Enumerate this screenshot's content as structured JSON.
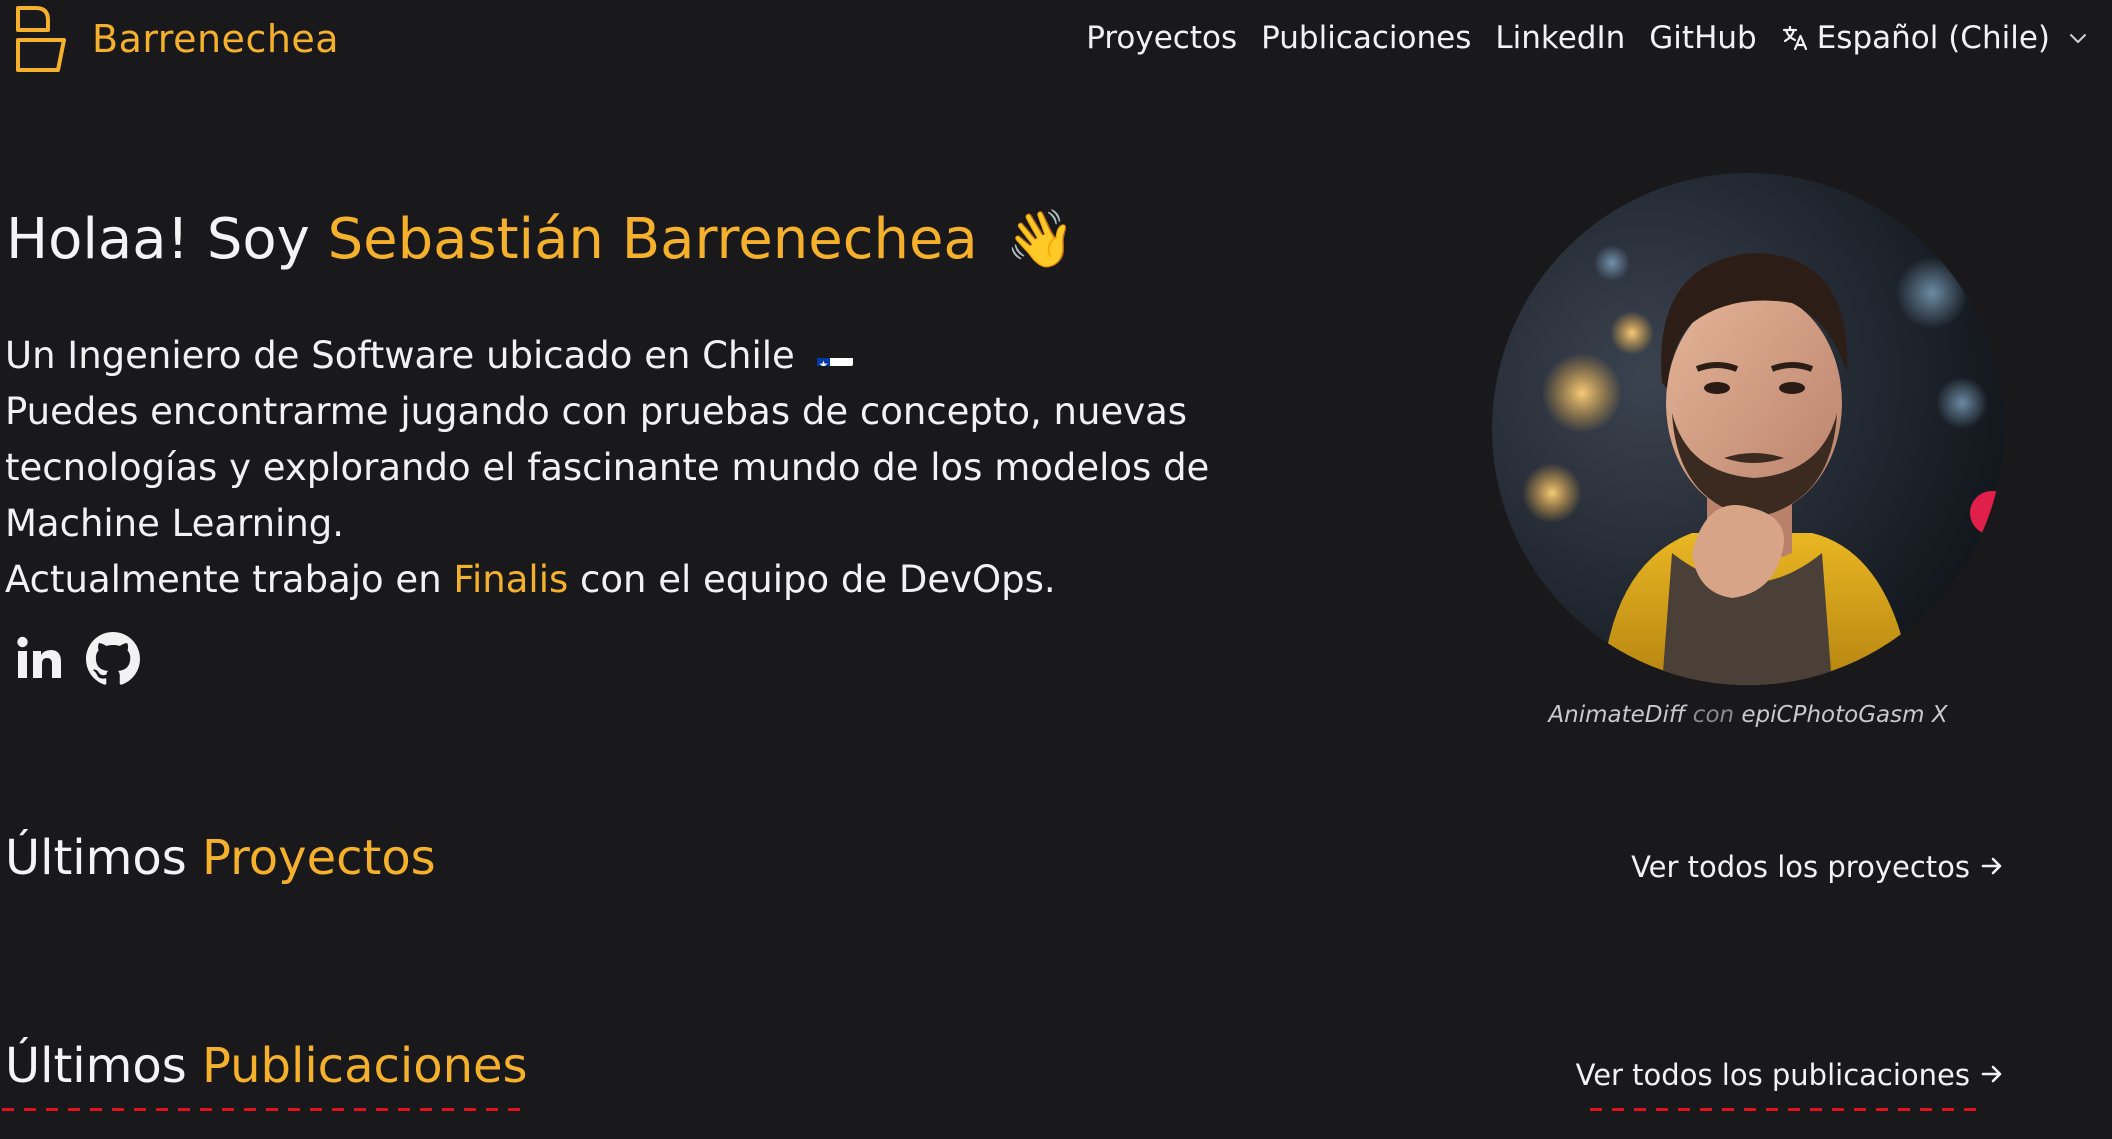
{
  "brand": {
    "name": "Barrenechea",
    "logo_icon": "folded-page-logo-icon"
  },
  "nav": {
    "links": [
      "Proyectos",
      "Publicaciones",
      "LinkedIn",
      "GitHub"
    ],
    "language": {
      "icon": "translate-icon",
      "label": "Español (Chile)"
    }
  },
  "hero": {
    "greeting": "Holaa! Soy ",
    "name": "Sebastián Barrenechea",
    "wave": "👋",
    "line1": "Un Ingeniero de Software ubicado en Chile",
    "flag_icon": "chile-flag-icon",
    "line2": "Puedes encontrarme jugando con pruebas de concepto, nuevas tecnologías y explorando el fascinante mundo de los modelos de Machine Learning.",
    "line3_prefix": "Actualmente trabajo en ",
    "company": "Finalis",
    "line3_suffix": " con el equipo de DevOps.",
    "social_icons": [
      "linkedin-icon",
      "github-icon"
    ]
  },
  "portrait": {
    "caption_tool": "AnimateDiff",
    "caption_joiner": "con",
    "caption_model": "epiCPhotoGasm X"
  },
  "projects": {
    "title_prefix": "Últimos ",
    "title_accent": "Proyectos",
    "see_all": "Ver todos los proyectos"
  },
  "publications": {
    "title_prefix": "Últimos ",
    "title_accent": "Publicaciones",
    "see_all": "Ver todos los publicaciones"
  },
  "colors": {
    "background": "#19191b",
    "accent": "#f5b12c",
    "text": "#f2f2f2",
    "underline": "#e0141f"
  }
}
